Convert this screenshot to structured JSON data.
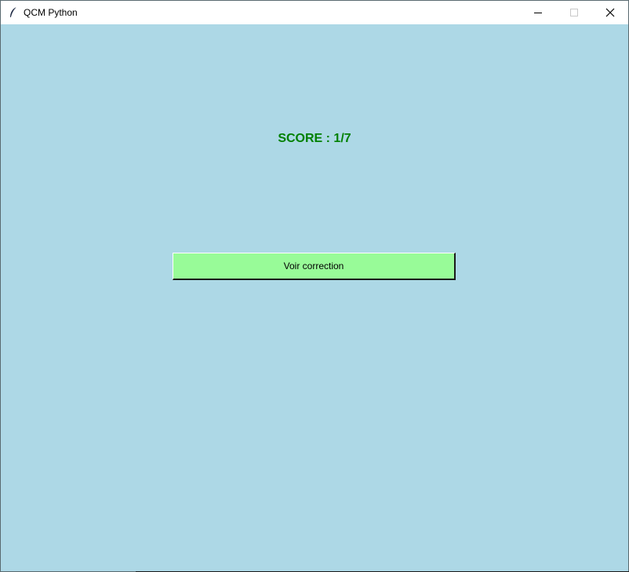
{
  "window": {
    "title": "QCM Python",
    "background_color": "#add8e6",
    "icons": {
      "app": "feather-icon",
      "minimize": "minimize-icon",
      "maximize": "maximize-icon",
      "close": "close-icon"
    }
  },
  "result": {
    "score_text": "SCORE : 1/7",
    "score_color": "#008000"
  },
  "actions": {
    "correction_label": "Voir correction",
    "correction_color": "#98fb98"
  }
}
